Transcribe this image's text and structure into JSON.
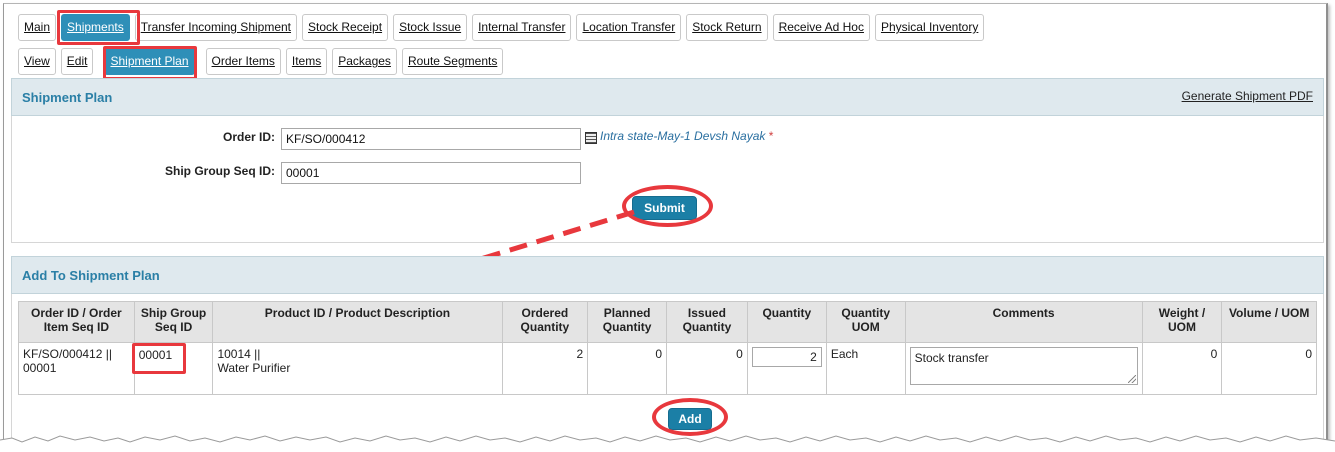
{
  "top_tabs": [
    "Main",
    "Shipments",
    "Transfer Incoming Shipment",
    "Stock Receipt",
    "Stock Issue",
    "Internal Transfer",
    "Location Transfer",
    "Stock Return",
    "Receive Ad Hoc",
    "Physical Inventory"
  ],
  "sub_tabs": [
    "View",
    "Edit",
    "Shipment Plan",
    "Order Items",
    "Items",
    "Packages",
    "Route Segments"
  ],
  "shipment_plan": {
    "title": "Shipment Plan",
    "generate_pdf": "Generate Shipment PDF",
    "order_id_label": "Order ID:",
    "order_id_value": "KF/SO/000412",
    "order_note": "Intra state-May-1 Devsh Nayak",
    "required_mark": "*",
    "ship_group_label": "Ship Group Seq ID:",
    "ship_group_value": "00001",
    "submit": "Submit"
  },
  "add_plan": {
    "title": "Add To Shipment Plan",
    "columns": [
      "Order ID / Order Item Seq ID",
      "Ship Group Seq ID",
      "Product ID / Product Description",
      "Ordered Quantity",
      "Planned Quantity",
      "Issued Quantity",
      "Quantity",
      "Quantity UOM",
      "Comments",
      "Weight / UOM",
      "Volume / UOM"
    ],
    "row": {
      "order_id": "KF/SO/000412 ||",
      "order_item_seq": "00001",
      "ship_group": "00001",
      "product_id": "10014 ||",
      "product_desc": "Water Purifier",
      "ordered": "2",
      "planned": "0",
      "issued": "0",
      "quantity": "2",
      "uom": "Each",
      "comments": "Stock transfer",
      "weight": "0",
      "volume": "0"
    },
    "add": "Add"
  },
  "colors": {
    "accent": "#2e8fb8",
    "highlight": "#e8383d",
    "panel_header": "#dfe9ee"
  }
}
